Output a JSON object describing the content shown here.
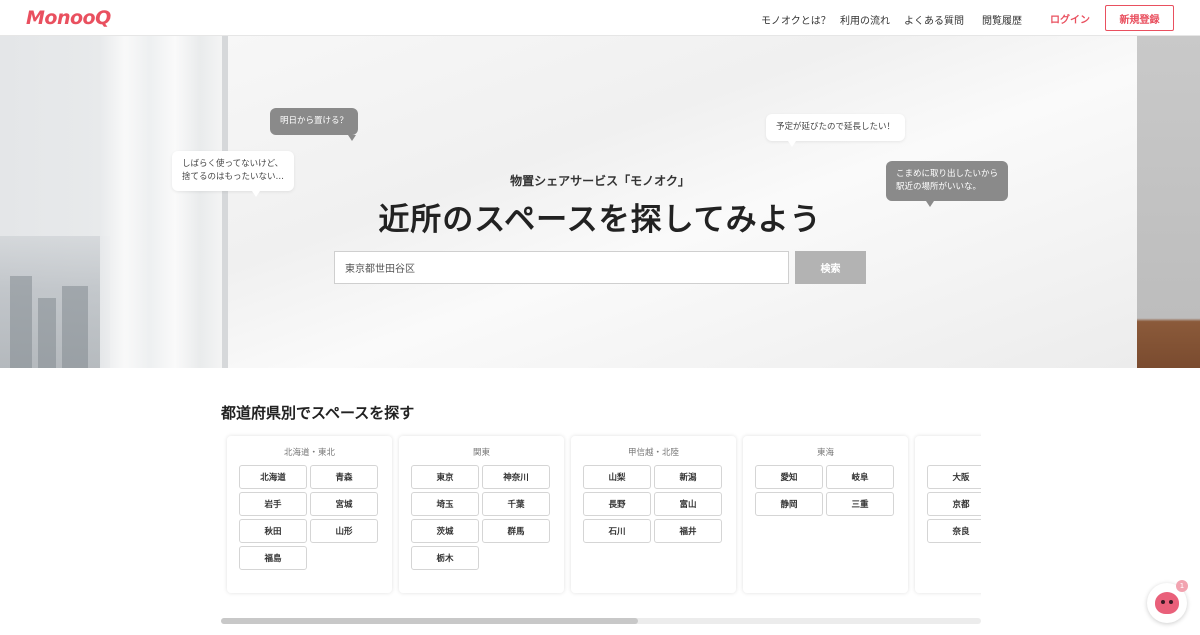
{
  "header": {
    "logo": "MonooQ",
    "nav": [
      "モノオクとは？",
      "利用の流れ",
      "よくある質問",
      "閲覧履歴"
    ],
    "login_label": "ログイン",
    "signup_label": "新規登録"
  },
  "hero": {
    "bubbles": [
      "明日から置ける？",
      "しばらく使ってないけど、\n捨てるのはもったいない…",
      "予定が延びたので延長したい！",
      "こまめに取り出したいから\n駅近の場所がいいな。"
    ],
    "subtitle": "物置シェアサービス「モノオク」",
    "title": "近所のスペースを探してみよう",
    "search_value": "東京都世田谷区",
    "search_button": "検索"
  },
  "prefectures": {
    "title": "都道府県別でスペースを探す",
    "regions": [
      {
        "name": "北海道・東北",
        "items": [
          "北海道",
          "青森",
          "岩手",
          "宮城",
          "秋田",
          "山形",
          "福島"
        ]
      },
      {
        "name": "関東",
        "items": [
          "東京",
          "神奈川",
          "埼玉",
          "千葉",
          "茨城",
          "群馬",
          "栃木"
        ]
      },
      {
        "name": "甲信越・北陸",
        "items": [
          "山梨",
          "新潟",
          "長野",
          "富山",
          "石川",
          "福井"
        ]
      },
      {
        "name": "東海",
        "items": [
          "愛知",
          "岐阜",
          "静岡",
          "三重"
        ]
      },
      {
        "name": "",
        "items": [
          "大阪",
          "",
          "京都",
          "",
          "奈良",
          ""
        ]
      }
    ]
  },
  "chat": {
    "badge": "1",
    "icon": "chat-mascot-icon"
  },
  "colors": {
    "brand": "#e9505f",
    "search_button": "#b3b3b3"
  }
}
